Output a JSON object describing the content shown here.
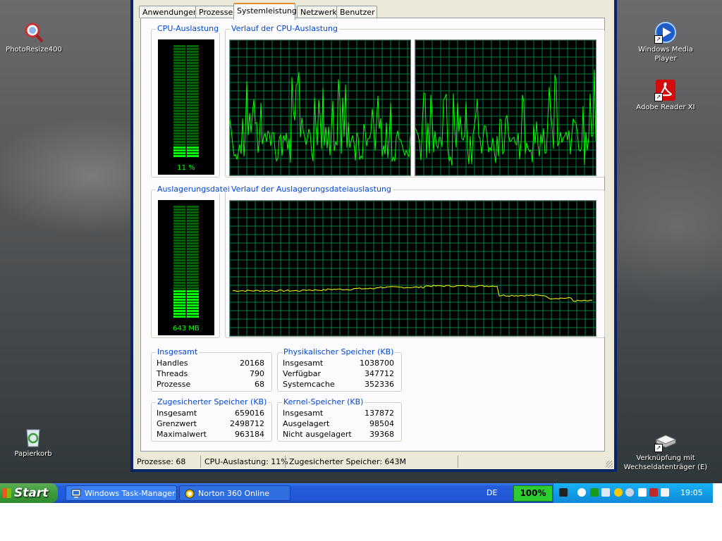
{
  "desktop": {
    "icons": [
      {
        "label": "PhotoResize400"
      },
      {
        "label": "Windows Media Player"
      },
      {
        "label": "Adobe Reader XI"
      },
      {
        "label": "Papierkorb"
      },
      {
        "label_line1": "Verknüpfung mit",
        "label_line2": "Wechseldatenträger (E)"
      }
    ]
  },
  "window": {
    "tabs": [
      "Anwendungen",
      "Prozesse",
      "Systemleistung",
      "Netzwerk",
      "Benutzer"
    ],
    "active_tab": "Systemleistung",
    "cpu_meter": {
      "title": "CPU-Auslastung",
      "value": "11 %",
      "fraction": 0.11
    },
    "cpu_history": {
      "title": "Verlauf der CPU-Auslastung"
    },
    "page_meter": {
      "title": "Auslagerungsdatei",
      "value": "643 MB",
      "fraction": 0.26
    },
    "page_history": {
      "title": "Verlauf der Auslagerungsdateiauslastung"
    },
    "totals": {
      "title": "Insgesamt",
      "rows": [
        {
          "k": "Handles",
          "v": "20168"
        },
        {
          "k": "Threads",
          "v": "790"
        },
        {
          "k": "Prozesse",
          "v": "68"
        }
      ]
    },
    "physical": {
      "title": "Physikalischer Speicher (KB)",
      "rows": [
        {
          "k": "Insgesamt",
          "v": "1038700"
        },
        {
          "k": "Verfügbar",
          "v": "347712"
        },
        {
          "k": "Systemcache",
          "v": "352336"
        }
      ]
    },
    "commit": {
      "title": "Zugesicherter Speicher (KB)",
      "rows": [
        {
          "k": "Insgesamt",
          "v": "659016"
        },
        {
          "k": "Grenzwert",
          "v": "2498712"
        },
        {
          "k": "Maximalwert",
          "v": "963184"
        }
      ]
    },
    "kernel": {
      "title": "Kernel-Speicher (KB)",
      "rows": [
        {
          "k": "Insgesamt",
          "v": "137872"
        },
        {
          "k": "Ausgelagert",
          "v": "98504"
        },
        {
          "k": "Nicht ausgelagert",
          "v": "39368"
        }
      ]
    },
    "status": {
      "processes": "Prozesse: 68",
      "cpu": "CPU-Auslastung: 11%",
      "commit": "Zugesicherter Speicher: 643M"
    }
  },
  "taskbar": {
    "start": "Start",
    "buttons": [
      "Windows Task-Manager",
      "Norton 360 Online"
    ],
    "language": "DE",
    "battery": "100%",
    "clock": "19:05"
  },
  "colors": {
    "graph_line": "#00ff00",
    "grid": "#008040",
    "page_line": "#ffff00",
    "link_blue": "#0046d5"
  },
  "icons": {
    "photoresize": "magnifier-icon",
    "media_player": "media-player-icon",
    "adobe": "pdf-icon",
    "recycle": "recycle-bin-icon",
    "drive": "removable-drive-icon"
  }
}
